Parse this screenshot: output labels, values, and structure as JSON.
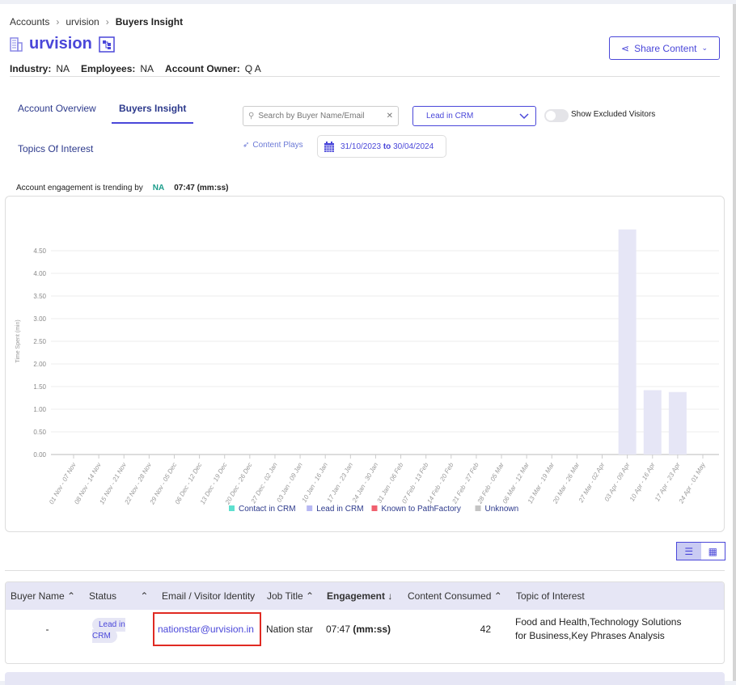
{
  "breadcrumb": [
    "Accounts",
    "urvision",
    "Buyers Insight"
  ],
  "account": {
    "name": "urvision",
    "industry_label": "Industry:",
    "industry": "NA",
    "employees_label": "Employees:",
    "employees": "NA",
    "owner_label": "Account Owner:",
    "owner": "Q A"
  },
  "share_label": "Share Content",
  "tabs": [
    {
      "label": "Account Overview"
    },
    {
      "label": "Buyers Insight",
      "active": true
    },
    {
      "label": "Topics Of Interest"
    }
  ],
  "search": {
    "placeholder": "Search by Buyer Name/Email",
    "value": ""
  },
  "status_filter": "Lead in CRM",
  "toggle_label": "Show Excluded Visitors",
  "toggle_on": false,
  "content_plays": "Content Plays",
  "date_range": {
    "from": "31/10/2023",
    "to_word": "to",
    "to": "30/04/2024"
  },
  "trend": {
    "label": "Account engagement is trending by",
    "value": "NA",
    "time": "07:47 (mm:ss)"
  },
  "colors": {
    "accent": "#4a47d9",
    "contact": "#5ee0cf",
    "lead": "#b7b8f3",
    "known": "#f0606e",
    "unknown": "#c4c4c4"
  },
  "chart_data": {
    "type": "bar",
    "ylabel": "Time Spent (min)",
    "ylim": [
      0,
      5
    ],
    "yticks": [
      "0.00",
      "0.50",
      "1.00",
      "1.50",
      "2.00",
      "2.50",
      "3.00",
      "3.50",
      "4.00",
      "4.50"
    ],
    "grid": true,
    "legend_position": "bottom",
    "categories": [
      "01 Nov - 07 Nov",
      "08 Nov - 14 Nov",
      "15 Nov - 21 Nov",
      "22 Nov - 28 Nov",
      "29 Nov - 05 Dec",
      "06 Dec - 12 Dec",
      "13 Dec - 19 Dec",
      "20 Dec - 26 Dec",
      "27 Dec - 02 Jan",
      "03 Jan - 09 Jan",
      "10 Jan - 16 Jan",
      "17 Jan - 23 Jan",
      "24 Jan - 30 Jan",
      "31 Jan - 06 Feb",
      "07 Feb - 13 Feb",
      "14 Feb - 20 Feb",
      "21 Feb - 27 Feb",
      "28 Feb - 05 Mar",
      "06 Mar - 12 Mar",
      "13 Mar - 19 Mar",
      "20 Mar - 26 Mar",
      "27 Mar - 02 Apr",
      "03 Apr - 09 Apr",
      "10 Apr - 16 Apr",
      "17 Apr - 23 Apr",
      "24 Apr - 01 May"
    ],
    "series": [
      {
        "name": "Contact in CRM",
        "values": [
          0,
          0,
          0,
          0,
          0,
          0,
          0,
          0,
          0,
          0,
          0,
          0,
          0,
          0,
          0,
          0,
          0,
          0,
          0,
          0,
          0,
          0,
          0,
          0,
          0,
          0
        ]
      },
      {
        "name": "Lead in CRM",
        "values": [
          0,
          0,
          0,
          0,
          0,
          0,
          0,
          0,
          0,
          0,
          0,
          0,
          0,
          0,
          0,
          0,
          0,
          0,
          0,
          0,
          0,
          0,
          4.97,
          1.42,
          1.38,
          0
        ]
      },
      {
        "name": "Known to PathFactory",
        "values": [
          0,
          0,
          0,
          0,
          0,
          0,
          0,
          0,
          0,
          0,
          0,
          0,
          0,
          0,
          0,
          0,
          0,
          0,
          0,
          0,
          0,
          0,
          0,
          0,
          0,
          0
        ]
      },
      {
        "name": "Unknown",
        "values": [
          0,
          0,
          0,
          0,
          0,
          0,
          0,
          0,
          0,
          0,
          0,
          0,
          0,
          0,
          0,
          0,
          0,
          0,
          0,
          0,
          0,
          0,
          0,
          0,
          0,
          0
        ]
      }
    ]
  },
  "table": {
    "columns": [
      "Buyer Name",
      "Status",
      "Email / Visitor Identity",
      "Job Title",
      "Engagement",
      "Content Consumed",
      "Topic of Interest"
    ],
    "rows": [
      {
        "buyer": "-",
        "status": "Lead in CRM",
        "email": "nationstar@urvision.in",
        "job": "Nation star",
        "engagement": "07:47",
        "engagement_unit": "(mm:ss)",
        "content": "42",
        "topics": "Food and Health,Technology Solutions for Business,Key Phrases Analysis"
      }
    ]
  }
}
